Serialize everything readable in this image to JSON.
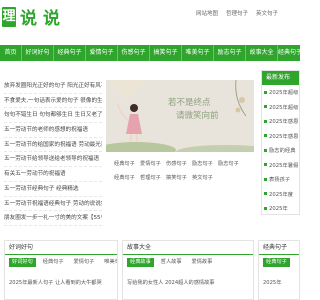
{
  "logo": {
    "mark": "理",
    "name": "说说"
  },
  "top_links": [
    "网站地图",
    "哲理句子",
    "英文句子"
  ],
  "nav": [
    "首页",
    "好词好句",
    "经典句子",
    "爱情句子",
    "伤感句子",
    "搞笑句子",
    "唯美句子",
    "励志句子",
    "故事大全",
    "经典句子"
  ],
  "news": [
    "放弃发圈阳光正好的句子 阳光正好有风不",
    "不食爱夫,一句话表示爱的句子 很像的生活",
    "句句不错生日 句句都够生日 生日又老了一",
    "五一劳动节的老师的感想的祝福语",
    "五一劳动节的给国家的祝福语 劳动最光荣",
    "五一劳动节给领导送给老领导的祝福语",
    "有关五一劳动节的祝福语",
    "五一劳动节经典句子 经典精选",
    "五一劳动节祝福语经典句子 劳动的说说集",
    "朋友圈发一步一礼一寸的美的文案【55句精"
  ],
  "banner": {
    "line1": "若不是终点",
    "line2": "请微笑向前"
  },
  "sub_links": [
    [
      "经典句子",
      "爱情句子",
      "伤感句子",
      "励志句子",
      "励志句子"
    ],
    [
      "经典句子",
      "哲理句子",
      "搞笑句子",
      "英文句子"
    ]
  ],
  "sidebar": {
    "title": "最新发布",
    "items": [
      "2025年超级",
      "2025年超级",
      "2025年感恩",
      "2025年感恩",
      "励志的经典",
      "2025年暑假",
      "表扬孩子",
      "2025年度",
      "2025年"
    ]
  },
  "sections": [
    {
      "title": "好词好句",
      "tabs": [
        "好词好句",
        "经典句子",
        "爱情句子",
        "唯美句子"
      ],
      "first_item": "2025年最新人句子 让人看到的大牛都哭"
    },
    {
      "title": "故事大全",
      "tabs": [
        "经典故事",
        "哲人故事",
        "爱情故事"
      ],
      "first_item": "写给我的女性人 2024超人的感情故事"
    },
    {
      "title": "经典句子",
      "tabs": [
        "经典句子"
      ],
      "first_item": "2025年"
    }
  ],
  "colors": {
    "brand": "#2fa52d",
    "banner_bg": "#e9e4db",
    "banner_text": "#8d9f7e"
  }
}
